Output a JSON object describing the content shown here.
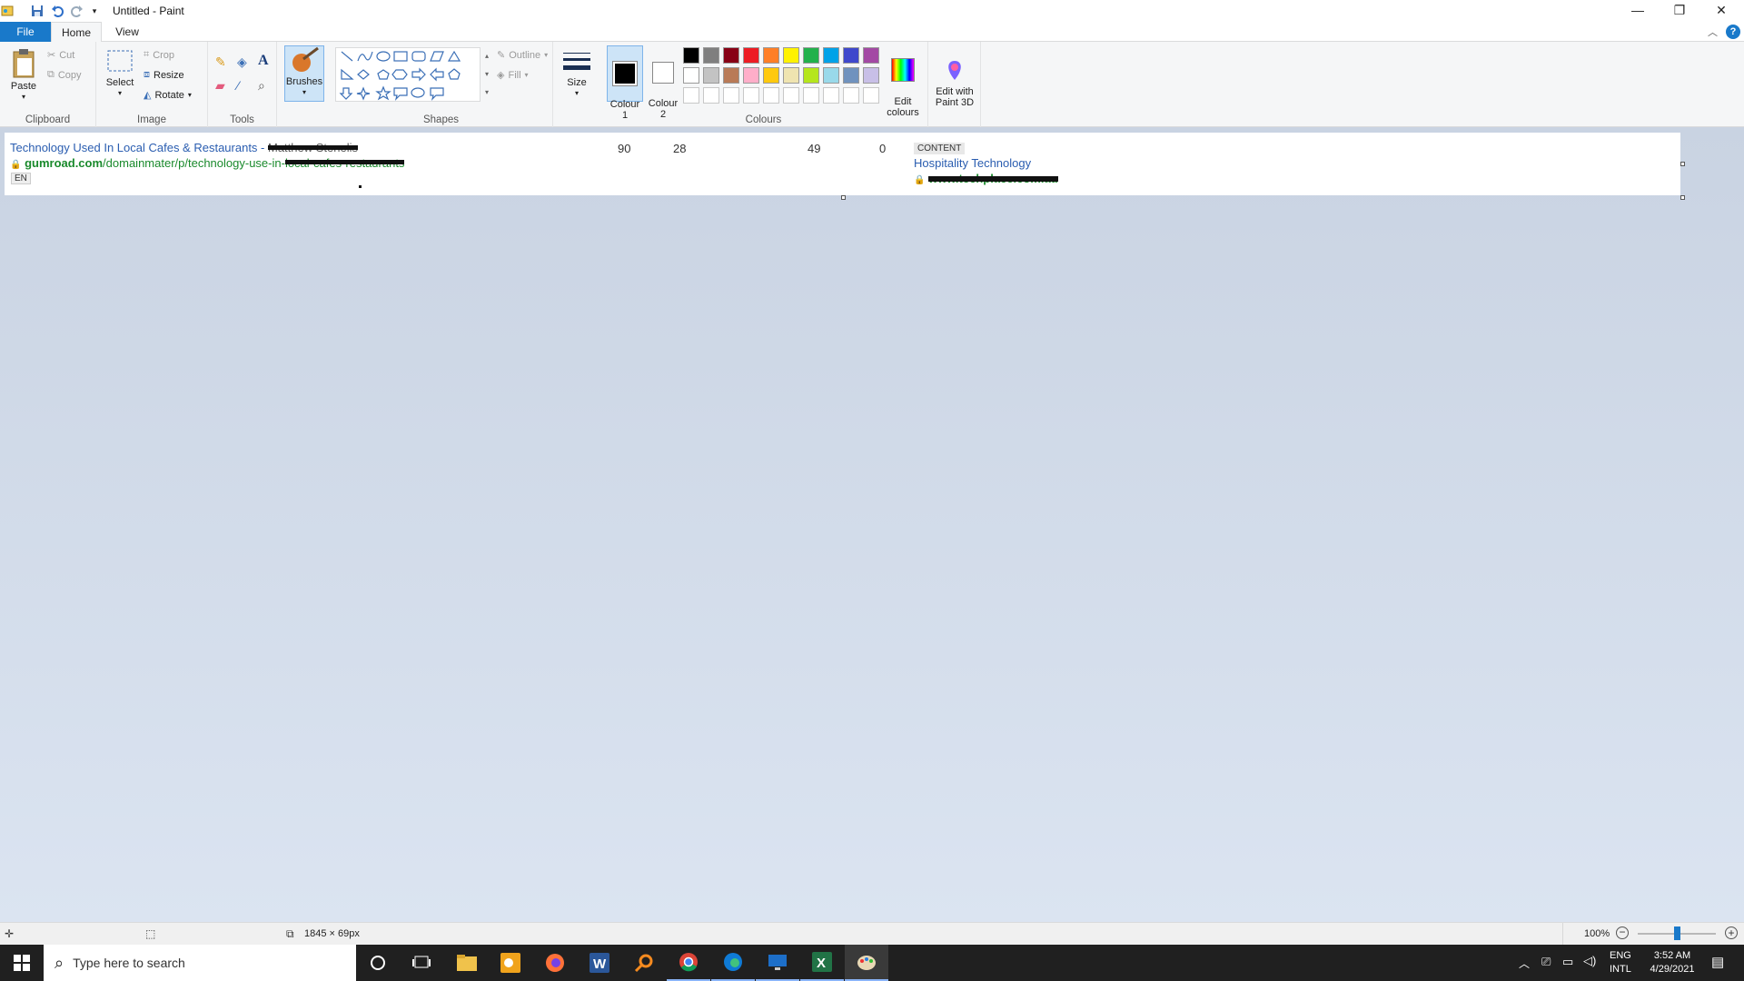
{
  "window": {
    "title": "Untitled - Paint"
  },
  "tabs": {
    "file": "File",
    "home": "Home",
    "view": "View"
  },
  "ribbon": {
    "clipboard": {
      "paste": "Paste",
      "cut": "Cut",
      "copy": "Copy",
      "label": "Clipboard"
    },
    "image": {
      "select": "Select",
      "crop": "Crop",
      "resize": "Resize",
      "rotate": "Rotate",
      "label": "Image"
    },
    "tools": {
      "label": "Tools"
    },
    "brushes": {
      "label": "Brushes"
    },
    "shapes": {
      "outline": "Outline",
      "fill": "Fill",
      "label": "Shapes"
    },
    "size": {
      "label": "Size"
    },
    "colours": {
      "colour1": "Colour\n1",
      "colour2": "Colour\n2",
      "edit": "Edit\ncolours",
      "label": "Colours",
      "palette_row1": [
        "#000000",
        "#7f7f7f",
        "#880015",
        "#ed1c24",
        "#ff7f27",
        "#fff200",
        "#22b14c",
        "#00a2e8",
        "#3f48cc",
        "#a349a4"
      ],
      "palette_row2": [
        "#ffffff",
        "#c3c3c3",
        "#b97a57",
        "#ffaec9",
        "#ffc90e",
        "#efe4b0",
        "#b5e61d",
        "#99d9ea",
        "#7092be",
        "#c8bfe7"
      ]
    },
    "paint3d": {
      "label": "Edit with\nPaint 3D"
    }
  },
  "canvas": {
    "row": {
      "title": "Technology Used In Local Cafes & Restaurants - ",
      "title_redacted": "Matthew Stenelis",
      "url_domain": "gumroad.com",
      "url_path": "/domainmater/p/technology-use-in-",
      "url_path_redacted": "local-cafes-restaurants",
      "lang": "EN",
      "num1": "90",
      "num2": "28",
      "num3": "49",
      "num4": "0",
      "badge": "CONTENT",
      "target_title": "Hospitality Technology",
      "target_url_redacted": "www.techplace.com.au"
    }
  },
  "status": {
    "dimensions": "1845 × 69px",
    "zoom": "100%"
  },
  "taskbar": {
    "search_placeholder": "Type here to search",
    "lang1": "ENG",
    "lang2": "INTL",
    "time": "3:52 AM",
    "date": "4/29/2021"
  }
}
